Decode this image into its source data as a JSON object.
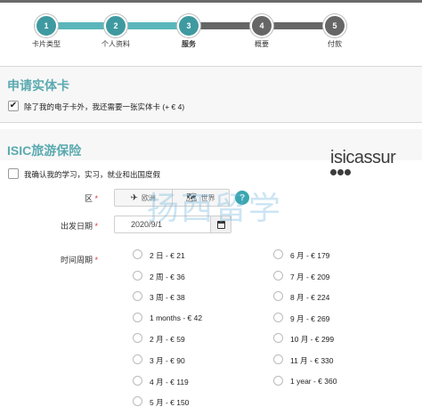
{
  "steps": [
    {
      "number": "1",
      "label": "卡片类型"
    },
    {
      "number": "2",
      "label": "个人资料"
    },
    {
      "number": "3",
      "label": "服务"
    },
    {
      "number": "4",
      "label": "概要"
    },
    {
      "number": "5",
      "label": "付款"
    }
  ],
  "physical_card": {
    "title": "申请实体卡",
    "checkbox_label": "除了我的电子卡外，我还需要一张实体卡 (+ € 4)",
    "checked": true,
    "check_mark": "✔"
  },
  "insurance": {
    "title": "ISIC旅游保险",
    "confirm_label": "我确认我的学习，实习，就业和出国度假",
    "logo_text": "isicassur",
    "region_label": "区",
    "region_options": [
      "欧洲",
      "世界"
    ],
    "help_symbol": "?",
    "start_date_label": "出发日期",
    "start_date_value": "2020/9/1",
    "period_label": "时间周期",
    "required_mark": "*",
    "periods_left": [
      "2 日 - € 21",
      "2 周 - € 36",
      "3 周 - € 38",
      "1 months - € 42",
      "2 月 - € 59",
      "3 月 - € 90",
      "4 月 - € 119",
      "5 月 - € 150"
    ],
    "periods_right": [
      "6 月 - € 179",
      "7 月 - € 209",
      "8 月 - € 224",
      "9 月 - € 269",
      "10 月 - € 299",
      "11 月 - € 330",
      "1 year - € 360"
    ]
  },
  "watermark": "扬西留学",
  "colors": {
    "accent": "#5ab6ba",
    "step_done": "#3e9aa0",
    "step_todo": "#666666",
    "required": "#dd3333"
  }
}
